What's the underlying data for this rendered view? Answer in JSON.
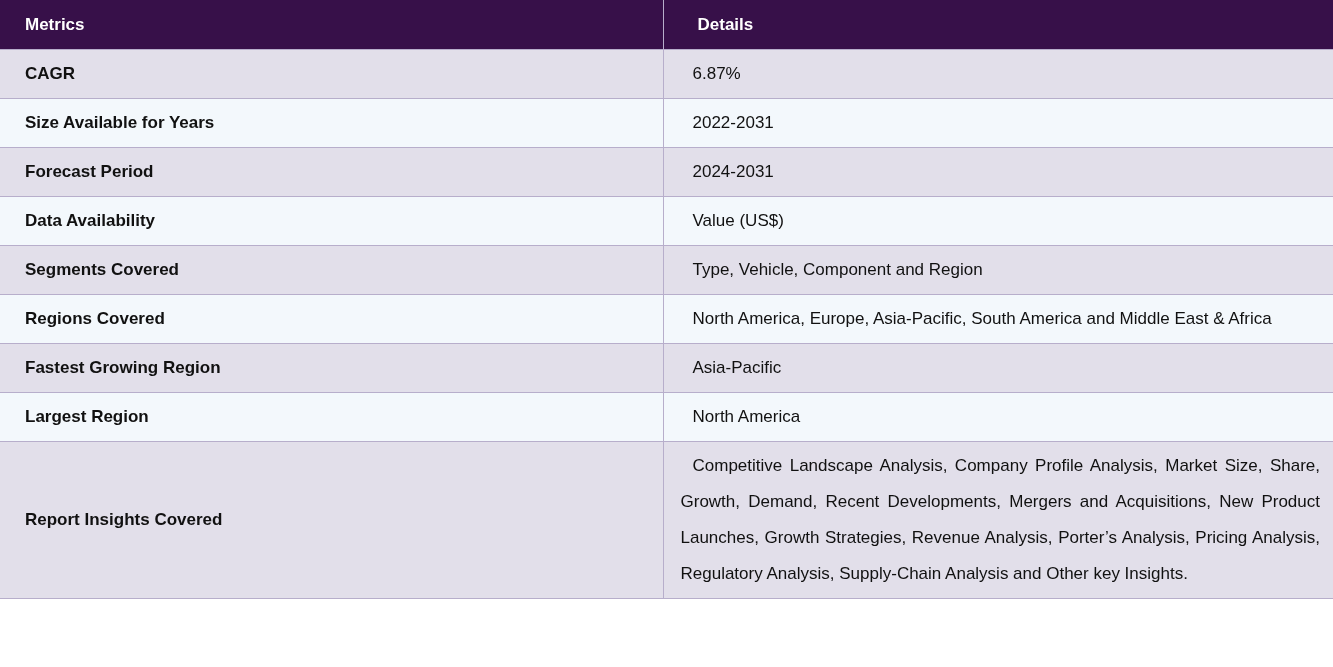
{
  "table": {
    "columns": [
      "Metrics",
      "Details"
    ],
    "rows": [
      {
        "metric": "CAGR",
        "detail": "6.87%"
      },
      {
        "metric": "Size Available for Years",
        "detail": "2022-2031"
      },
      {
        "metric": "Forecast Period",
        "detail": "2024-2031"
      },
      {
        "metric": "Data Availability",
        "detail": "Value (US$)"
      },
      {
        "metric": "Segments Covered",
        "detail": "Type, Vehicle, Component and Region"
      },
      {
        "metric": "Regions Covered",
        "detail": "North America, Europe, Asia-Pacific, South America and Middle East & Africa"
      },
      {
        "metric": "Fastest Growing Region",
        "detail": "Asia-Pacific"
      },
      {
        "metric": "Largest Region",
        "detail": "North America"
      },
      {
        "metric": "Report Insights Covered",
        "detail": "Competitive Landscape Analysis, Company Profile Analysis, Market Size, Share, Growth, Demand, Recent Developments, Mergers and Acquisitions, New Product Launches, Growth Strategies, Revenue Analysis, Porter’s Analysis, Pricing Analysis, Regulatory Analysis, Supply-Chain Analysis and Other key Insights."
      }
    ]
  }
}
